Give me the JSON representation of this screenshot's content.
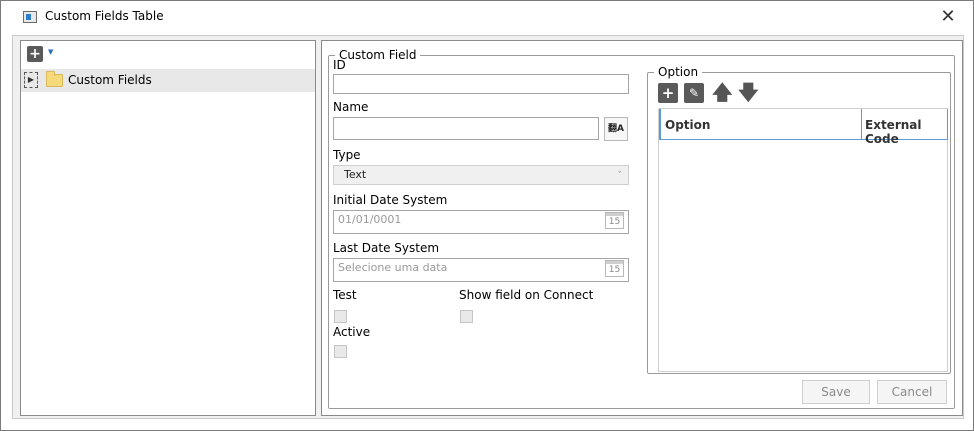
{
  "window": {
    "title": "Custom Fields Table",
    "close_symbol": "✕",
    "icon": "app-window-icon"
  },
  "tree": {
    "add_symbol": "+",
    "add_caret": "▼",
    "items": [
      {
        "label": "Custom Fields",
        "expander": "▶",
        "icon": "folder-icon"
      }
    ]
  },
  "custom_field": {
    "legend": "Custom Field",
    "id_label": "ID",
    "id_value": "",
    "name_label": "Name",
    "name_value": "",
    "translate_icon": "翻A",
    "type_label": "Type",
    "type_value": "Text",
    "type_chevron": "˅",
    "initial_date_label": "Initial Date System",
    "initial_date_value": "01/01/0001",
    "last_date_label": "Last Date System",
    "last_date_placeholder": "Selecione uma data",
    "calendar_day": "15",
    "test_label": "Test",
    "show_field_label": "Show field on Connect",
    "active_label": "Active",
    "test_checked": false,
    "show_field_checked": false,
    "active_checked": false
  },
  "option": {
    "legend": "Option",
    "add_symbol": "+",
    "edit_symbol": "✎",
    "up_symbol": "🡅",
    "down_symbol": "🡇",
    "columns": [
      "Option",
      "External Code"
    ],
    "rows": []
  },
  "actions": {
    "save_label": "Save",
    "cancel_label": "Cancel"
  },
  "colors": {
    "accent": "#5b9bd5",
    "folder": "#f6d97a"
  }
}
